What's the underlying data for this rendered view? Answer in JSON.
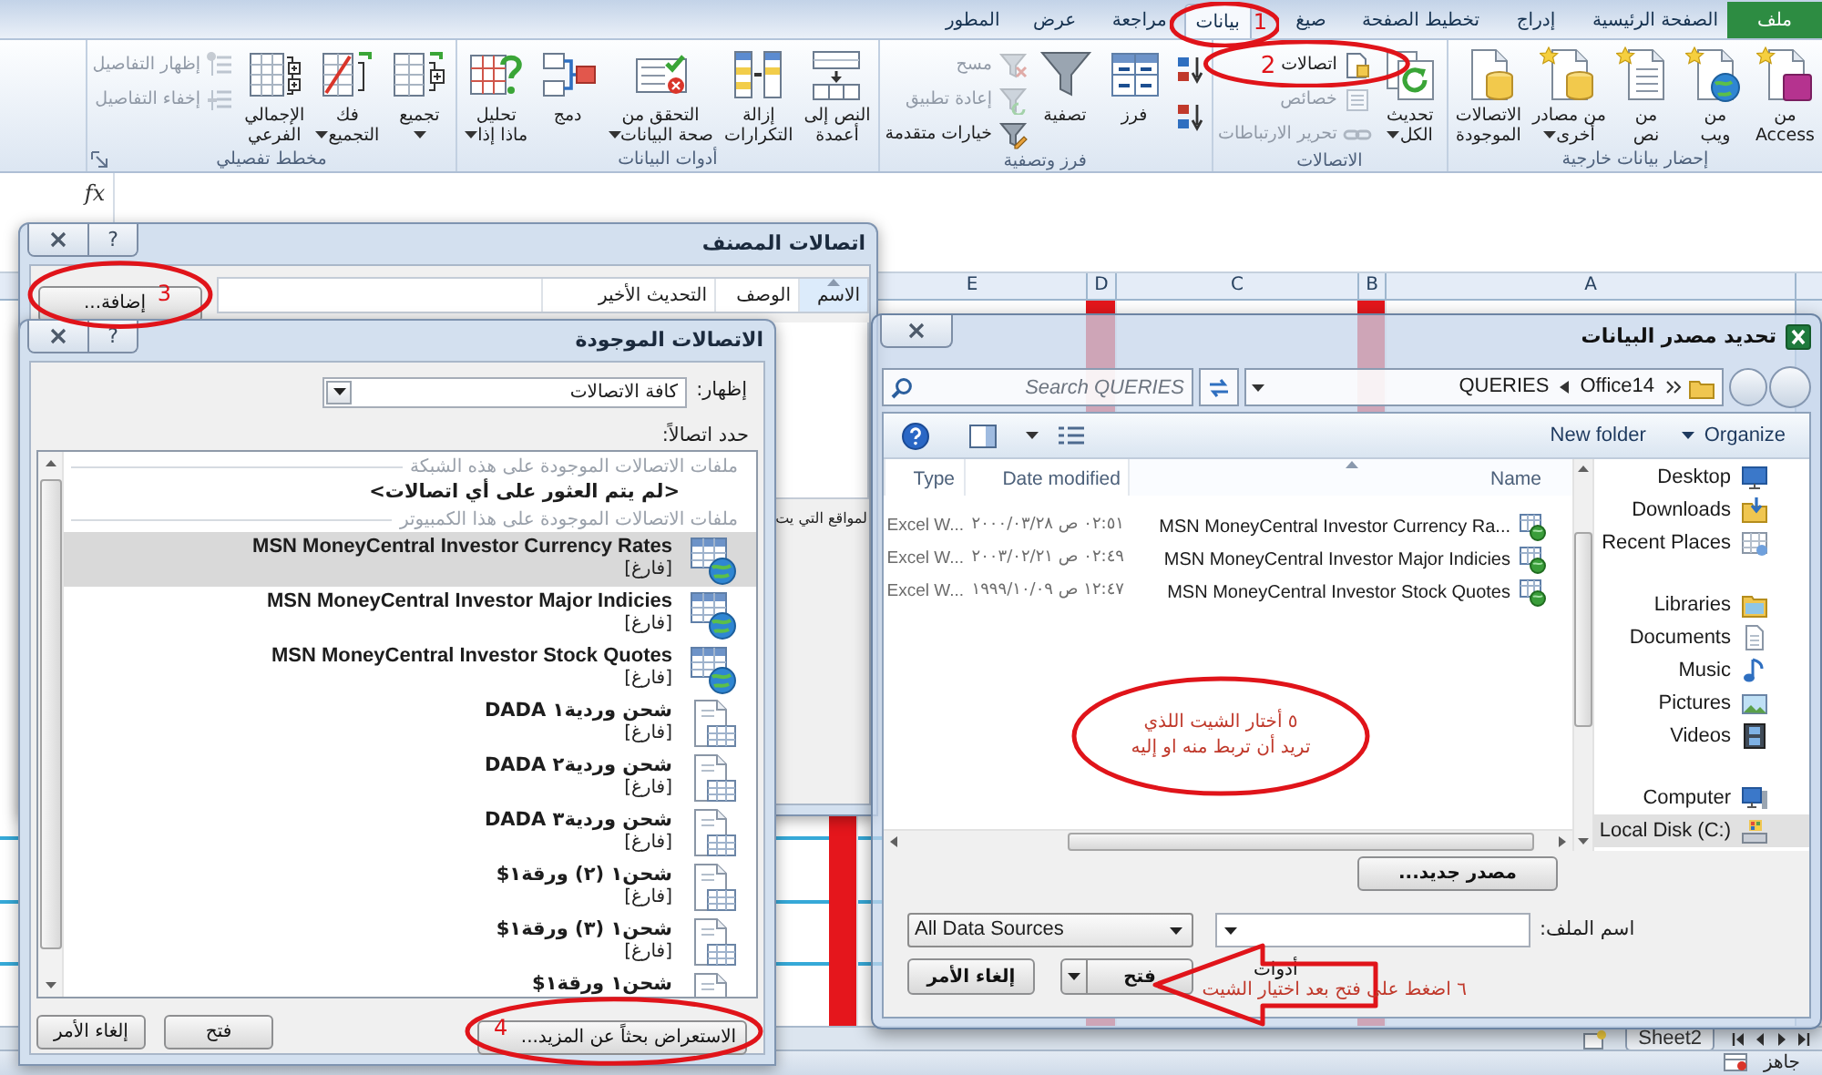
{
  "tabs": [
    {
      "label": "ملف",
      "kind": "file",
      "selected": false
    },
    {
      "label": "الصفحة الرئيسية",
      "kind": "tab",
      "selected": false
    },
    {
      "label": "إدراج",
      "kind": "tab",
      "selected": false
    },
    {
      "label": "تخطيط الصفحة",
      "kind": "tab",
      "selected": false
    },
    {
      "label": "صيغ",
      "kind": "tab",
      "selected": false
    },
    {
      "label": "بيانات",
      "kind": "tab",
      "selected": true,
      "callout": "1"
    },
    {
      "label": "مراجعة",
      "kind": "tab",
      "selected": false
    },
    {
      "label": "عرض",
      "kind": "tab",
      "selected": false
    },
    {
      "label": "المطور",
      "kind": "tab",
      "selected": false
    }
  ],
  "ribbon": {
    "groups": [
      {
        "label": "إحضار بيانات خارجية",
        "launcher": false,
        "items": [
          {
            "label": "من\nAccess",
            "kind": "large",
            "disabled": false,
            "menu": false
          },
          {
            "label": "من\nويب",
            "kind": "large",
            "disabled": false,
            "menu": false
          },
          {
            "label": "من\nنص",
            "kind": "large",
            "disabled": false,
            "menu": false
          },
          {
            "label": "من مصادر\nأخرى",
            "kind": "large",
            "disabled": false,
            "menu": true
          },
          {
            "label": "الاتصالات\nالموجودة",
            "kind": "large",
            "disabled": false,
            "menu": false
          }
        ]
      },
      {
        "label": "الاتصالات",
        "launcher": false,
        "items": [
          {
            "label": "تحديث\nالكل",
            "kind": "large",
            "disabled": false,
            "menu": true
          },
          {
            "label": "اتصالات",
            "kind": "small",
            "disabled": false,
            "menu": false,
            "callout": "2"
          },
          {
            "label": "خصائص",
            "kind": "small",
            "disabled": true,
            "menu": false
          },
          {
            "label": "تحرير الارتباطات",
            "kind": "small",
            "disabled": true,
            "menu": false
          }
        ]
      },
      {
        "label": "فرز وتصفية",
        "launcher": false,
        "items": [
          {
            "kind": "icon",
            "disabled": false,
            "menu": false
          },
          {
            "kind": "icon",
            "disabled": false,
            "menu": false
          },
          {
            "label": "فرز",
            "kind": "large",
            "disabled": false,
            "menu": false
          },
          {
            "label": "تصفية",
            "kind": "large",
            "disabled": false,
            "menu": false
          },
          {
            "label": "مسح",
            "kind": "small",
            "disabled": true,
            "menu": false
          },
          {
            "label": "إعادة تطبيق",
            "kind": "small",
            "disabled": true,
            "menu": false
          },
          {
            "label": "خيارات متقدمة",
            "kind": "small",
            "disabled": false,
            "menu": false
          }
        ]
      },
      {
        "label": "أدوات البيانات",
        "launcher": false,
        "items": [
          {
            "label": "النص إلى\nأعمدة",
            "kind": "large",
            "disabled": false,
            "menu": false
          },
          {
            "label": "إزالة\nالتكرارات",
            "kind": "large",
            "disabled": false,
            "menu": false
          },
          {
            "label": "التحقق من\nصحة البيانات",
            "kind": "large",
            "disabled": false,
            "menu": true
          },
          {
            "label": "دمج",
            "kind": "large",
            "disabled": false,
            "menu": false
          },
          {
            "label": "تحليل\nماذا إذا",
            "kind": "large",
            "disabled": false,
            "menu": true
          }
        ]
      },
      {
        "label": "مخطط تفصيلي",
        "launcher": true,
        "items": [
          {
            "label": "تجميع",
            "kind": "large",
            "disabled": false,
            "menu": true
          },
          {
            "label": "فك\nالتجميع",
            "kind": "large",
            "disabled": false,
            "menu": true
          },
          {
            "label": "الإجمالي\nالفرعي",
            "kind": "large",
            "disabled": false,
            "menu": false
          },
          {
            "label": "إظهار التفاصيل",
            "kind": "small",
            "disabled": true,
            "menu": false
          },
          {
            "label": "إخفاء التفاصيل",
            "kind": "small",
            "disabled": true,
            "menu": false
          }
        ]
      }
    ]
  },
  "formula_bar": {
    "function_label": "fx"
  },
  "sheet": {
    "columns": [
      {
        "label": "A",
        "filled": false
      },
      {
        "label": "B",
        "filled": true
      },
      {
        "label": "C",
        "filled": false
      },
      {
        "label": "D",
        "filled": true
      },
      {
        "label": "E",
        "filled": false
      },
      {
        "filled": true
      }
    ]
  },
  "workbook_connections_dialog": {
    "title": "اتصالات المصنف",
    "help": "?",
    "columns": [
      {
        "label": "الاسم",
        "sorted": true
      },
      {
        "label": "الوصف",
        "sorted": false
      },
      {
        "label": "التحديث الأخير",
        "sorted": false
      }
    ],
    "add_button": {
      "label": "إضافة...",
      "callout": "3"
    },
    "text": "لمواقع التي يت"
  },
  "existing_connections_dialog": {
    "title": "الاتصالات الموجودة",
    "help": "?",
    "show_label": "إظهار:",
    "show_value": "كافة الاتصالات",
    "select_label": "حدد اتصالاً:",
    "items": [
      {
        "kind": "header",
        "label": "ملفات الاتصالات الموجودة على هذه الشبكة",
        "selected": false
      },
      {
        "kind": "none",
        "label": "<لم يتم العثور على أي اتصالات>",
        "selected": false
      },
      {
        "kind": "header",
        "label": "ملفات الاتصالات الموجودة على هذا الكمبيوتر",
        "selected": false
      },
      {
        "kind": "web",
        "label": "MSN MoneyCentral Investor Currency Rates",
        "note": "[فارغ]",
        "selected": true
      },
      {
        "kind": "web",
        "label": "MSN MoneyCentral Investor Major Indicies",
        "note": "[فارغ]",
        "selected": false
      },
      {
        "kind": "web",
        "label": "MSN MoneyCentral Investor Stock Quotes",
        "note": "[فارغ]",
        "selected": false
      },
      {
        "kind": "file",
        "label": "شحن وردية١ DADA",
        "note": "[فارغ]",
        "selected": false
      },
      {
        "kind": "file",
        "label": "شحن وردية٢ DADA",
        "note": "[فارغ]",
        "selected": false
      },
      {
        "kind": "file",
        "label": "شحن وردية٣ DADA",
        "note": "[فارغ]",
        "selected": false
      },
      {
        "kind": "file",
        "label": "شحن١ (٢) ورقة١$",
        "note": "[فارغ]",
        "selected": false
      },
      {
        "kind": "file",
        "label": "شحن١ (٣) ورقة١$",
        "note": "[فارغ]",
        "selected": false
      },
      {
        "kind": "file",
        "label": "شحن١ ورقة١$",
        "selected": false
      }
    ],
    "buttons": [
      {
        "kind": "browse",
        "label": "الاستعراض بحثاً عن المزيد...",
        "callout": "4"
      },
      {
        "kind": "open",
        "label": "فتح"
      },
      {
        "kind": "cancel",
        "label": "إلغاء الأمر"
      }
    ]
  },
  "data_source_dialog": {
    "title": "تحديد مصدر البيانات",
    "breadcrumb": [
      {
        "label": "Office14"
      },
      {
        "label": "QUERIES"
      }
    ],
    "search": {
      "placeholder": "Search QUERIES"
    },
    "toolbar": [
      {
        "label": "Organize",
        "menu": true
      },
      {
        "label": "New folder",
        "menu": false
      }
    ],
    "nav_sections": [
      {
        "items": [
          {
            "label": "Desktop",
            "selected": false
          },
          {
            "label": "Downloads",
            "selected": false
          },
          {
            "label": "Recent Places",
            "selected": false
          }
        ]
      },
      {
        "items": [
          {
            "label": "Libraries",
            "selected": false
          },
          {
            "label": "Documents",
            "selected": false
          },
          {
            "label": "Music",
            "selected": false
          },
          {
            "label": "Pictures",
            "selected": false
          },
          {
            "label": "Videos",
            "selected": false
          }
        ]
      },
      {
        "items": [
          {
            "label": "Computer",
            "selected": false
          },
          {
            "label": "Local Disk (C:)",
            "selected": true
          }
        ]
      }
    ],
    "columns": [
      {
        "label": "Name",
        "sorted": true
      },
      {
        "label": "Date modified",
        "sorted": false
      },
      {
        "label": "Type",
        "sorted": false
      }
    ],
    "files": [
      {
        "name": "MSN MoneyCentral Investor Currency Ra...",
        "date": "٠٢:٥١ ص ٢٠٠٠/٠٣/٢٨",
        "type": "Excel W..."
      },
      {
        "name": "MSN MoneyCentral Investor Major Indicies",
        "date": "٠٢:٤٩ ص ٢٠٠٣/٠٢/٢١",
        "type": "Excel W..."
      },
      {
        "name": "MSN MoneyCentral Investor Stock Quotes",
        "date": "١٢:٤٧ ص ١٩٩٩/١٠/٠٩",
        "type": "Excel W..."
      }
    ],
    "new_source_button": "مصدر جديد...",
    "file_name_label": "اسم الملف:",
    "file_type": "All Data Sources",
    "tools_button": "أدوات",
    "open_button": "فتح",
    "cancel_button": "إلغاء الأمر"
  },
  "sheet_tabs": [
    {
      "label": "Sheet2",
      "selected": false
    }
  ],
  "status_bar": {
    "text": "جاهز"
  },
  "annotations": [
    {
      "kind": "ellipse",
      "text": "٥ أختار الشيت اللذي\nتريد أن تربط منه او إليه"
    },
    {
      "kind": "arrow",
      "text": "٦ اضغط على فتح بعد اختيار الشيت"
    }
  ]
}
